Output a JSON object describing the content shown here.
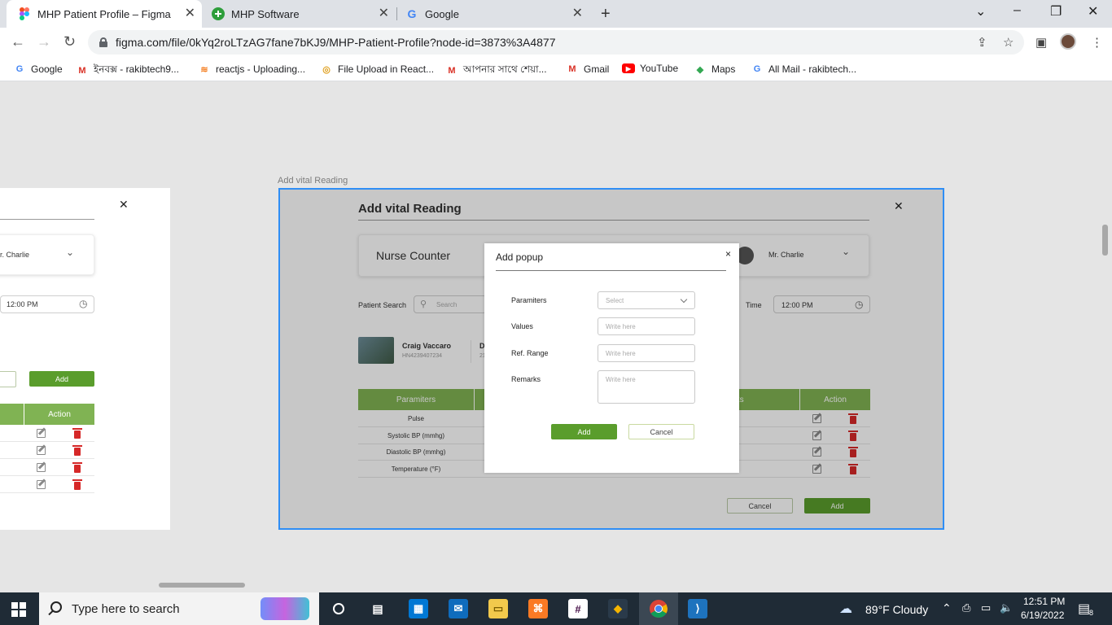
{
  "browser": {
    "tabs": [
      {
        "title": "MHP Patient Profile – Figma"
      },
      {
        "title": "MHP Software"
      },
      {
        "title": "Google"
      }
    ],
    "url": "figma.com/file/0kYq2roLTzAG7fane7bKJ9/MHP-Patient-Profile?node-id=3873%3A4877",
    "bookmarks": [
      {
        "label": "Google"
      },
      {
        "label": "ইনবক্স - rakibtech9..."
      },
      {
        "label": "reactjs - Uploading..."
      },
      {
        "label": "File Upload in React..."
      },
      {
        "label": "আপনার সাথে শেয়া..."
      },
      {
        "label": "Gmail"
      },
      {
        "label": "YouTube"
      },
      {
        "label": "Maps"
      },
      {
        "label": "All Mail - rakibtech..."
      }
    ]
  },
  "canvas": {
    "frame_label": "Add vital Reading",
    "left_frame": {
      "doctor": "r. Charlie",
      "time": "12:00 PM",
      "add_button": "Add",
      "action_header": "Action"
    },
    "main_frame": {
      "title": "Add vital Reading",
      "counter": "Nurse Counter",
      "doctor": "Mr. Charlie",
      "patient_search_label": "Patient Search",
      "search_placeholder": "Search",
      "time_label": "Time",
      "time_value": "12:00 PM",
      "patient_name": "Craig Vaccaro",
      "patient_id": "HN4239407234",
      "patient_d": "D",
      "patient_d2": "21",
      "table_headers": {
        "param": "Paramiters",
        "remarks": "rks",
        "action": "Action"
      },
      "rows": [
        "Pulse",
        "Systolic BP (mmhg)",
        "Diastolic BP (mmhg)",
        "Temperature (°F)"
      ],
      "cancel_button": "Cancel",
      "add_button": "Add"
    },
    "popup": {
      "title": "Add popup",
      "close": "×",
      "fields": [
        {
          "label": "Paramiters",
          "placeholder": "Select"
        },
        {
          "label": "Values",
          "placeholder": "Write here"
        },
        {
          "label": "Ref. Range",
          "placeholder": "Write here"
        },
        {
          "label": "Remarks",
          "placeholder": "Write here"
        }
      ],
      "add_button": "Add",
      "cancel_button": "Cancel"
    }
  },
  "taskbar": {
    "search_placeholder": "Type here to search",
    "weather": "89°F  Cloudy",
    "time": "12:51 PM",
    "date": "6/19/2022",
    "notifications": "8"
  },
  "colors": {
    "accent_green": "#5a9d2c",
    "table_green": "#80b353",
    "selection_blue": "#2f8ef5"
  }
}
